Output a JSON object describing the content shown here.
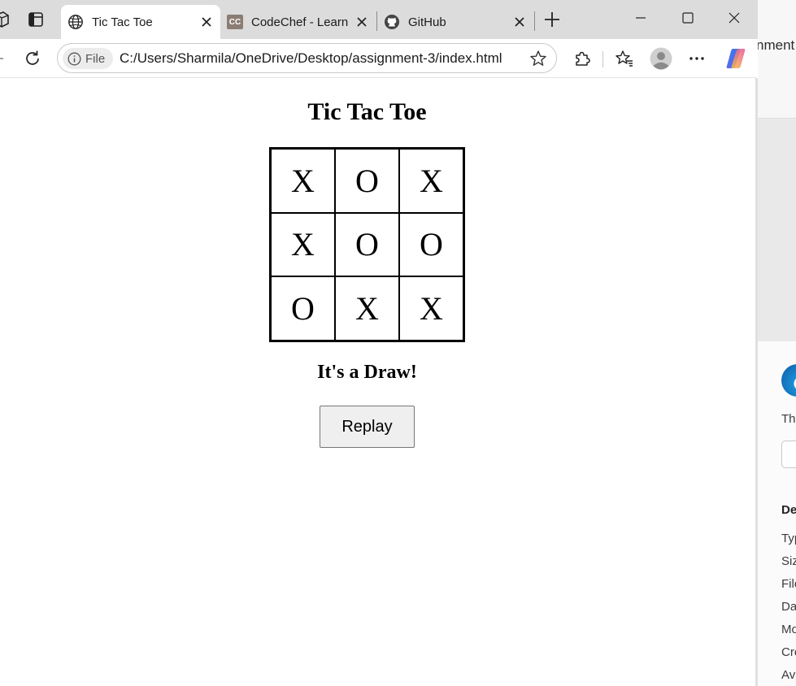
{
  "browser": {
    "tabs": [
      {
        "title": "Tic Tac Toe",
        "icon": "globe-icon",
        "active": true
      },
      {
        "title": "CodeChef - Learn",
        "icon": "codechef-icon",
        "favicon_text": "CC",
        "active": false
      },
      {
        "title": "GitHub",
        "icon": "github-icon",
        "active": false
      }
    ],
    "address": {
      "scheme_label": "File",
      "url": "C:/Users/Sharmila/OneDrive/Desktop/assignment-3/index.html"
    }
  },
  "side_pane": {
    "header_partial": "nment",
    "snippet_partial": "Thi",
    "section_partial": "De",
    "rows_partial": [
      "Typ",
      "Siz",
      "File",
      "Da",
      "Mo",
      "Cre",
      "Ava"
    ]
  },
  "game": {
    "title": "Tic Tac Toe",
    "board": [
      "X",
      "O",
      "X",
      "X",
      "O",
      "O",
      "O",
      "X",
      "X"
    ],
    "status": "It's a Draw!",
    "replay_label": "Replay"
  },
  "colors": {
    "tabbar_bg": "#dcdcdc",
    "copilot_gradient": [
      "#2870ea",
      "#e84fa1",
      "#f9c23c"
    ]
  }
}
